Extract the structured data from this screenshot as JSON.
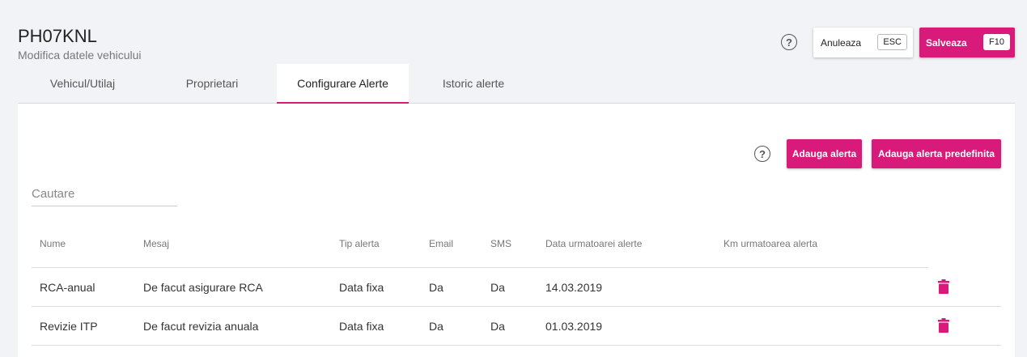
{
  "header": {
    "title": "PH07KNL",
    "subtitle": "Modifica datele vehicului",
    "help_glyph": "?",
    "cancel_label": "Anuleaza",
    "cancel_key": "ESC",
    "save_label": "Salveaza",
    "save_key": "F10"
  },
  "tabs": [
    {
      "label": "Vehicul/Utilaj"
    },
    {
      "label": "Proprietari"
    },
    {
      "label": "Configurare Alerte",
      "active": true
    },
    {
      "label": "Istoric alerte"
    }
  ],
  "alerts": {
    "help_glyph": "?",
    "add_label": "Adauga alerta",
    "add_predefined_label": "Adauga alerta predefinita",
    "search_placeholder": "Cautare",
    "columns": [
      "Nume",
      "Mesaj",
      "Tip alerta",
      "Email",
      "SMS",
      "Data urmatoarei alerte",
      "Km urmatoarea alerta"
    ],
    "rows": [
      {
        "name": "RCA-anual",
        "message": "De facut asigurare RCA",
        "type": "Data fixa",
        "email": "Da",
        "sms": "Da",
        "next_date": "14.03.2019",
        "next_km": ""
      },
      {
        "name": "Revizie ITP",
        "message": "De facut revizia anuala",
        "type": "Data fixa",
        "email": "Da",
        "sms": "Da",
        "next_date": "01.03.2019",
        "next_km": ""
      }
    ]
  },
  "colors": {
    "accent": "#d81b7b",
    "background": "#f1f3f6"
  },
  "icons": {
    "help": "help-circle-icon",
    "delete": "trash-icon"
  }
}
